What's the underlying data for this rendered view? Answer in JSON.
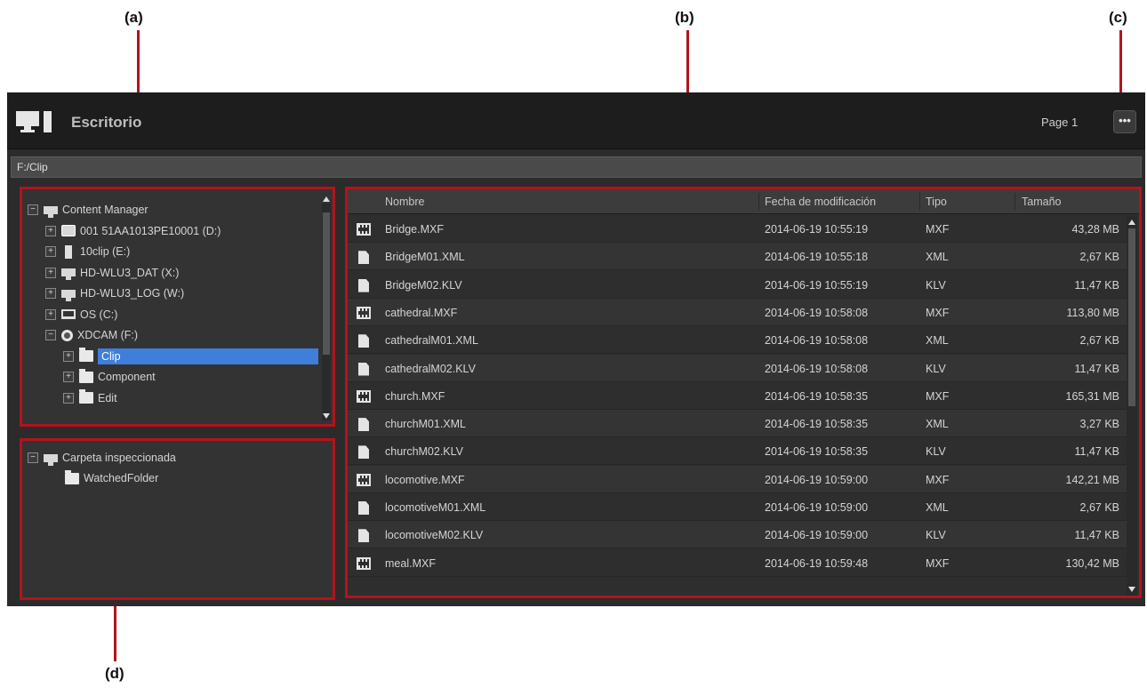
{
  "callouts": {
    "a": "(a)",
    "b": "(b)",
    "c": "(c)",
    "d": "(d)"
  },
  "window": {
    "title": "Escritorio",
    "page_label": "Page 1",
    "more_label": "•••",
    "path": "F:/Clip"
  },
  "tree": {
    "items": [
      {
        "label": "Content Manager",
        "icon": "pc-icon",
        "expander": "−"
      },
      {
        "label": "001 51AA1013PE10001 (D:)",
        "icon": "drive-icon",
        "expander": "+"
      },
      {
        "label": "10clip (E:)",
        "icon": "usb-stick-icon",
        "expander": "+"
      },
      {
        "label": "HD-WLU3_DAT (X:)",
        "icon": "network-drive-icon",
        "expander": "+"
      },
      {
        "label": "HD-WLU3_LOG (W:)",
        "icon": "network-drive-icon",
        "expander": "+"
      },
      {
        "label": "OS (C:)",
        "icon": "laptop-icon",
        "expander": "+"
      },
      {
        "label": "XDCAM (F:)",
        "icon": "disc-icon",
        "expander": "−"
      },
      {
        "label": "Clip",
        "icon": "folder-icon",
        "expander": "+"
      },
      {
        "label": "Component",
        "icon": "folder-icon",
        "expander": "+"
      },
      {
        "label": "Edit",
        "icon": "folder-icon",
        "expander": "+"
      }
    ]
  },
  "watched": {
    "root": "Carpeta inspeccionada",
    "items": [
      "WatchedFolder"
    ]
  },
  "list": {
    "columns": {
      "name": "Nombre",
      "date": "Fecha de modificación",
      "type": "Tipo",
      "size": "Tamaño"
    },
    "rows": [
      {
        "name": "Bridge.MXF",
        "date": "2014-06-19 10:55:19",
        "type": "MXF",
        "size": "43,28 MB",
        "icon": "film-icon"
      },
      {
        "name": "BridgeM01.XML",
        "date": "2014-06-19 10:55:18",
        "type": "XML",
        "size": "2,67 KB",
        "icon": "document-icon"
      },
      {
        "name": "BridgeM02.KLV",
        "date": "2014-06-19 10:55:19",
        "type": "KLV",
        "size": "11,47 KB",
        "icon": "document-icon"
      },
      {
        "name": "cathedral.MXF",
        "date": "2014-06-19 10:58:08",
        "type": "MXF",
        "size": "113,80 MB",
        "icon": "film-icon"
      },
      {
        "name": "cathedralM01.XML",
        "date": "2014-06-19 10:58:08",
        "type": "XML",
        "size": "2,67 KB",
        "icon": "document-icon"
      },
      {
        "name": "cathedralM02.KLV",
        "date": "2014-06-19 10:58:08",
        "type": "KLV",
        "size": "11,47 KB",
        "icon": "document-icon"
      },
      {
        "name": "church.MXF",
        "date": "2014-06-19 10:58:35",
        "type": "MXF",
        "size": "165,31 MB",
        "icon": "film-icon"
      },
      {
        "name": "churchM01.XML",
        "date": "2014-06-19 10:58:35",
        "type": "XML",
        "size": "3,27 KB",
        "icon": "document-icon"
      },
      {
        "name": "churchM02.KLV",
        "date": "2014-06-19 10:58:35",
        "type": "KLV",
        "size": "11,47 KB",
        "icon": "document-icon"
      },
      {
        "name": "locomotive.MXF",
        "date": "2014-06-19 10:59:00",
        "type": "MXF",
        "size": "142,21 MB",
        "icon": "film-icon"
      },
      {
        "name": "locomotiveM01.XML",
        "date": "2014-06-19 10:59:00",
        "type": "XML",
        "size": "2,67 KB",
        "icon": "document-icon"
      },
      {
        "name": "locomotiveM02.KLV",
        "date": "2014-06-19 10:59:00",
        "type": "KLV",
        "size": "11,47 KB",
        "icon": "document-icon"
      },
      {
        "name": "meal.MXF",
        "date": "2014-06-19 10:59:48",
        "type": "MXF",
        "size": "130,42 MB",
        "icon": "film-icon"
      }
    ]
  }
}
